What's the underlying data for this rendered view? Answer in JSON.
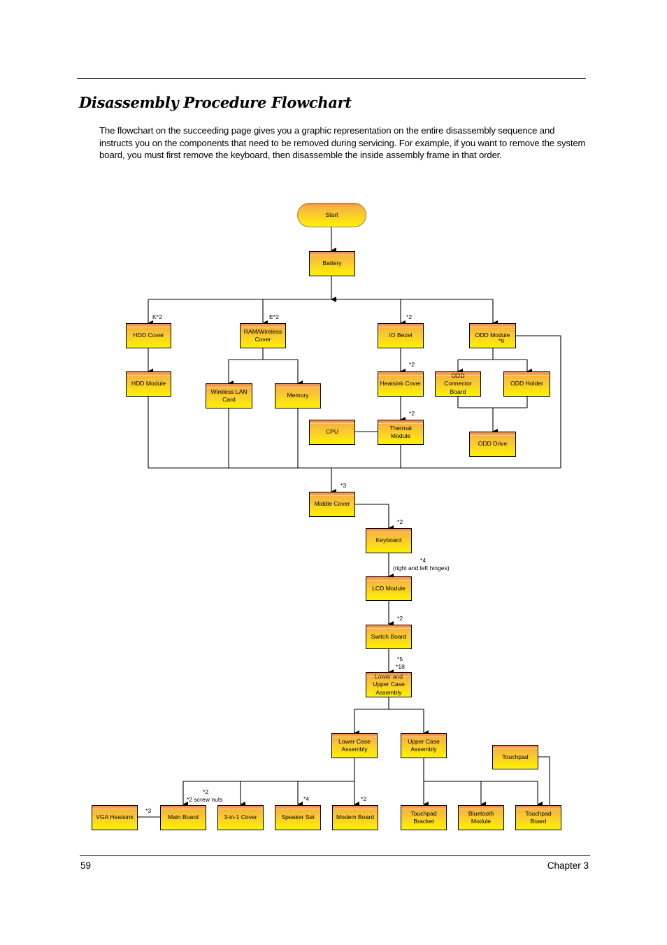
{
  "page": {
    "title": "Disassembly Procedure Flowchart",
    "intro": "The flowchart on the succeeding page gives you a graphic representation on the entire disassembly sequence and instructs you on the components that need to be removed during servicing. For example, if you want to remove the system board, you must first remove the keyboard, then disassemble the inside assembly frame in that order.",
    "page_number": "59",
    "chapter": "Chapter 3"
  },
  "flowchart": {
    "nodes": {
      "start": "Start",
      "battery": "Battery",
      "hdd_cover": "HDD Cover",
      "ram_wireless_cover": "RAM/Wireless Cover",
      "io_bezel": "IO Bezel",
      "odd_module": "ODD Module",
      "hdd_module": "HDD Module",
      "wireless_lan_card": "Wireless LAN Card",
      "memory": "Memory",
      "heatsink_cover": "Heatsink Cover",
      "odd_connector_board": "ODD Connector Board",
      "odd_holder": "ODD Holder",
      "cpu": "CPU",
      "thermal_module": "Thermal Module",
      "odd_drive": "ODD Drive",
      "middle_cover": "Middle Cover",
      "keyboard": "Keyboard",
      "lcd_module": "LCD Module",
      "switch_board": "Switch Board",
      "lower_upper_case": "Lower and Upper Case Assembly",
      "lower_case": "Lower Case Assembly",
      "upper_case": "Upper Case Assembly",
      "touchpad": "Touchpad",
      "vga_heatsink": "VGA Heatsink",
      "main_board": "Main Board",
      "three_in_one_cover": "3-in-1 Cover",
      "speaker_set": "Speaker Set",
      "modem_board": "Modem Board",
      "touchpad_bracket": "Touchpad Bracket",
      "bluetooth_module": "Bluetooth Module",
      "touchpad_board": "Touchpad Board"
    },
    "notes": {
      "hdd_cover": "K*2",
      "ram_cover": "E*2",
      "io_bezel": "*2",
      "odd_module": "*6",
      "heatsink_cover": "*2",
      "thermal_module": "*2",
      "middle_cover": "*3",
      "keyboard": "*2",
      "lcd_module_1": "*4",
      "lcd_module_2": "(right and left hinges)",
      "switch_board": "*2",
      "case_1": "*5",
      "case_2": "*18",
      "main_board_1": "*2",
      "main_board_2": "*2 screw nuts",
      "vga_heatsink": "*3",
      "speaker_set": "*4",
      "modem_board": "*2"
    }
  }
}
